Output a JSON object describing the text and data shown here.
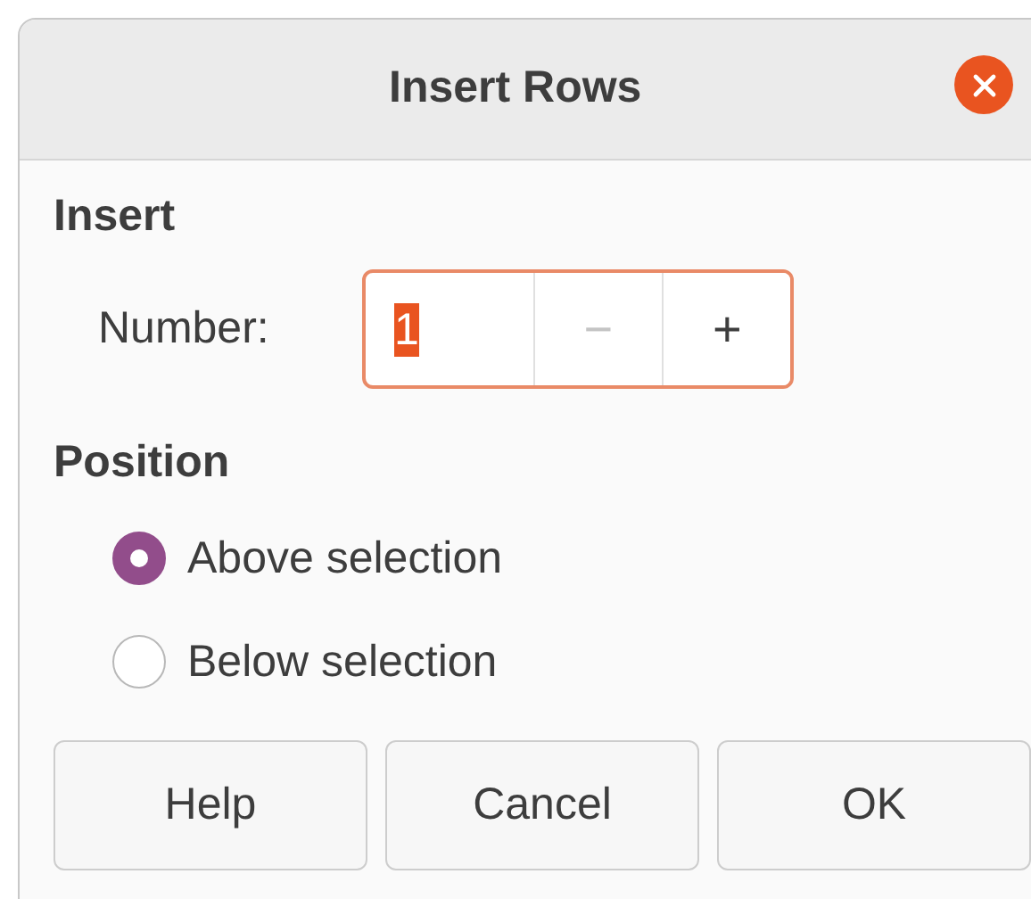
{
  "window": {
    "title": "Insert Rows"
  },
  "insert": {
    "heading": "Insert",
    "number": {
      "label": "Number:",
      "value": "1",
      "value_selected": true,
      "minus": {
        "symbol": "−",
        "disabled": true
      },
      "plus": {
        "symbol": "+",
        "disabled": false
      }
    }
  },
  "position": {
    "heading": "Position",
    "options": [
      {
        "label": "Above selection",
        "selected": true
      },
      {
        "label": "Below selection",
        "selected": false
      }
    ]
  },
  "buttons": [
    "Help",
    "Cancel",
    "OK"
  ]
}
